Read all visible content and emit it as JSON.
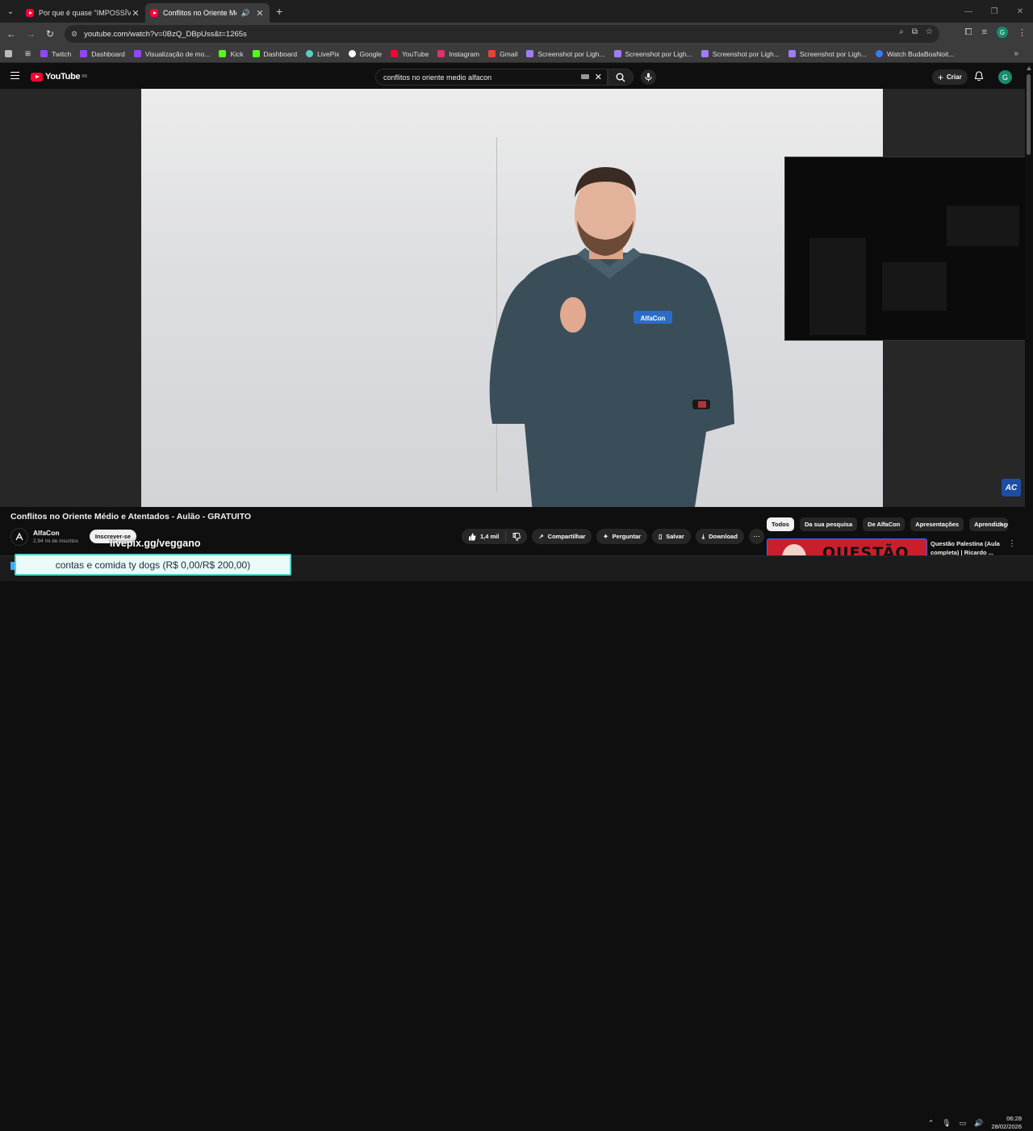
{
  "browser": {
    "tabs": [
      {
        "title": "Por que é quase \"IMPOSSÍVEL\"",
        "active": false
      },
      {
        "title": "Conflitos no Oriente Médio",
        "active": true
      }
    ],
    "url": "youtube.com/watch?v=0BzQ_DBpUss&t=1265s",
    "bookmarks": [
      {
        "label": "Twitch",
        "color": "#9146ff"
      },
      {
        "label": "Dashboard",
        "color": "#9146ff"
      },
      {
        "label": "Visualização de mo...",
        "color": "#9146ff"
      },
      {
        "label": "Kick",
        "color": "#53fc18"
      },
      {
        "label": "Dashboard",
        "color": "#53fc18"
      },
      {
        "label": "LivePix",
        "color": "#4fd1c5"
      },
      {
        "label": "Google",
        "color": "#ffffff"
      },
      {
        "label": "YouTube",
        "color": "#ff0033"
      },
      {
        "label": "Instagram",
        "color": "#e1306c"
      },
      {
        "label": "Gmail",
        "color": "#ea4335"
      },
      {
        "label": "Screenshot por Ligh...",
        "color": "#a17cff"
      },
      {
        "label": "Screenshot por Ligh...",
        "color": "#a17cff"
      },
      {
        "label": "Screenshot por Ligh...",
        "color": "#a17cff"
      },
      {
        "label": "Screenshot por Ligh...",
        "color": "#a17cff"
      },
      {
        "label": "Watch BudaBoaNoit...",
        "color": "#3a7bff"
      }
    ]
  },
  "youtube": {
    "logo": "YouTube",
    "logo_region": "BR",
    "search_query": "conflitos no oriente medio alfacon",
    "create_label": "Criar",
    "avatar_letter": "G"
  },
  "video": {
    "title": "Conflitos no Oriente Médio e Atentados - Aulão - GRATUITO",
    "channel": "AlfaCon",
    "subscribers": "2,94 mi de inscritos",
    "subscribe_label": "Inscrever-se",
    "likes": "1,4 mil",
    "share_label": "Compartilhar",
    "ask_label": "Perguntar",
    "save_label": "Salvar",
    "download_label": "Download",
    "shirt_logo_text": "AlfaCon",
    "watermark": "AC"
  },
  "chips": [
    "Todos",
    "Da sua pesquisa",
    "De AlfaCon",
    "Apresentações",
    "Aprendizagem"
  ],
  "recommended": {
    "thumb_text": "QUESTÃO",
    "title": "Questão Palestina (Aula completa) | Ricardo ..."
  },
  "stream_overlay": {
    "link": "livepix.gg/veggano",
    "donation": "contas e comida ty dogs (R$ 0,00/R$ 200,00)"
  },
  "clock": {
    "time": "06:28",
    "date": "28/02/2026"
  }
}
